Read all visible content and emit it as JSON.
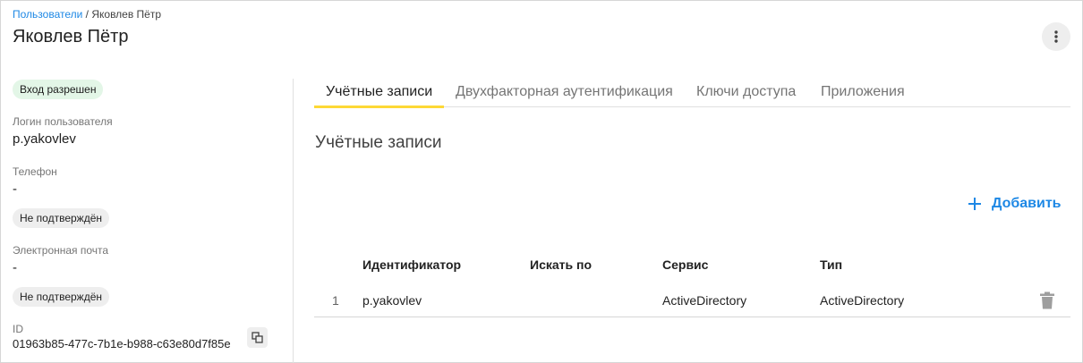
{
  "breadcrumb": {
    "parent": "Пользователи",
    "separator": " / ",
    "current": "Яковлев Пётр"
  },
  "page": {
    "title": "Яковлев Пётр",
    "more_icon": "more-vertical-icon"
  },
  "profile": {
    "status_badge": "Вход разрешен",
    "login_label": "Логин пользователя",
    "login_value": "p.yakovlev",
    "phone_label": "Телефон",
    "phone_value": "-",
    "phone_badge": "Не подтверждён",
    "email_label": "Электронная почта",
    "email_value": "-",
    "email_badge": "Не подтверждён",
    "id_label": "ID",
    "id_value": "01963b85-477c-7b1e-b988-c63e80d7f85e",
    "copy_icon": "copy-icon"
  },
  "tabs": [
    {
      "label": "Учётные записи",
      "active": true
    },
    {
      "label": "Двухфакторная аутентификация",
      "active": false
    },
    {
      "label": "Ключи доступа",
      "active": false
    },
    {
      "label": "Приложения",
      "active": false
    }
  ],
  "accounts": {
    "title": "Учётные записи",
    "add_label": "Добавить",
    "add_icon": "plus-icon",
    "columns": [
      "Идентификатор",
      "Искать по",
      "Сервис",
      "Тип"
    ],
    "rows": [
      {
        "num": "1",
        "identifier": "p.yakovlev",
        "search_by": "",
        "service": "ActiveDirectory",
        "type": "ActiveDirectory",
        "delete_icon": "trash-icon"
      }
    ]
  },
  "colors": {
    "accent": "#1e88e5",
    "tab_indicator": "#fdd835",
    "status_green_bg": "#e3f6e7",
    "chip_grey_bg": "#eeeeee"
  }
}
